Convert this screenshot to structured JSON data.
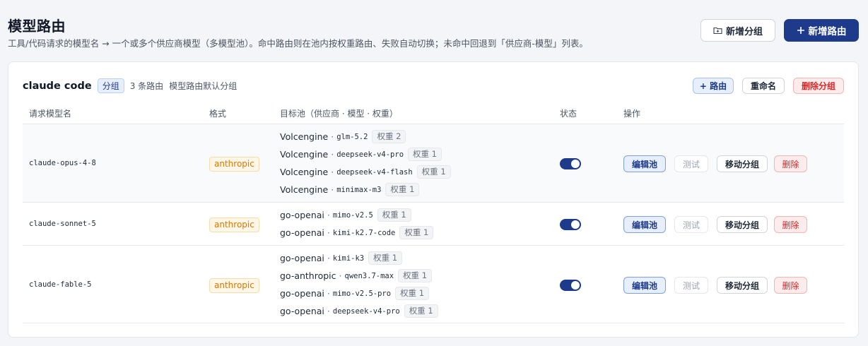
{
  "page": {
    "title": "模型路由",
    "description": "工具/代码请求的模型名 → 一个或多个供应商模型（多模型池）。命中路由则在池内按权重路由、失败自动切换；未命中回退到「供应商-模型」列表。"
  },
  "toolbar": {
    "new_group_label": "新增分组",
    "new_route_label": "新增路由",
    "new_group_icon": "folder-plus-icon",
    "new_route_icon": "plus-icon"
  },
  "group": {
    "name": "claude code",
    "tag": "分组",
    "count_text": "3 条路由",
    "default_text": "模型路由默认分组",
    "add_route_label": "+ 路由",
    "rename_label": "重命名",
    "delete_label": "删除分组"
  },
  "table": {
    "headers": {
      "model": "请求模型名",
      "format": "格式",
      "pool": "目标池（供应商 · 模型 · 权重）",
      "status": "状态",
      "actions": "操作"
    },
    "actions": {
      "edit": "编辑池",
      "test": "测试",
      "move": "移动分组",
      "delete": "删除"
    },
    "rows": [
      {
        "model": "claude-opus-4-8",
        "format": "anthropic",
        "enabled": true,
        "targets": [
          {
            "provider": "Volcengine",
            "model": "glm-5.2",
            "weight": "权重 2"
          },
          {
            "provider": "Volcengine",
            "model": "deepseek-v4-pro",
            "weight": "权重 1"
          },
          {
            "provider": "Volcengine",
            "model": "deepseek-v4-flash",
            "weight": "权重 1"
          },
          {
            "provider": "Volcengine",
            "model": "minimax-m3",
            "weight": "权重 1"
          }
        ]
      },
      {
        "model": "claude-sonnet-5",
        "format": "anthropic",
        "enabled": true,
        "targets": [
          {
            "provider": "go-openai",
            "model": "mimo-v2.5",
            "weight": "权重 1"
          },
          {
            "provider": "go-openai",
            "model": "kimi-k2.7-code",
            "weight": "权重 1"
          }
        ]
      },
      {
        "model": "claude-fable-5",
        "format": "anthropic",
        "enabled": true,
        "targets": [
          {
            "provider": "go-openai",
            "model": "kimi-k3",
            "weight": "权重 1"
          },
          {
            "provider": "go-anthropic",
            "model": "qwen3.7-max",
            "weight": "权重 1"
          },
          {
            "provider": "go-openai",
            "model": "mimo-v2.5-pro",
            "weight": "权重 1"
          },
          {
            "provider": "go-openai",
            "model": "deepseek-v4-pro",
            "weight": "权重 1"
          }
        ]
      }
    ]
  },
  "colors": {
    "primary": "#1e3a8a",
    "danger": "#dc2626",
    "format_badge": "#d97706",
    "background": "#f4f5f8"
  }
}
